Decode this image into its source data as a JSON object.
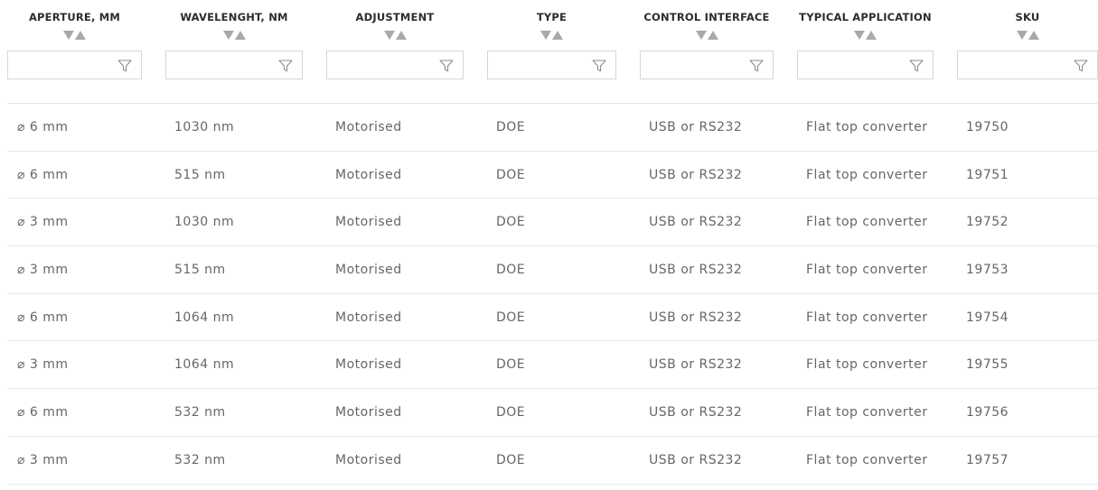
{
  "columns": [
    {
      "key": "aperture",
      "label": "APERTURE, MM"
    },
    {
      "key": "wavelength",
      "label": "WAVELENGHT, NM"
    },
    {
      "key": "adjustment",
      "label": "ADJUSTMENT"
    },
    {
      "key": "type",
      "label": "TYPE"
    },
    {
      "key": "interface",
      "label": "CONTROL INTERFACE"
    },
    {
      "key": "application",
      "label": "TYPICAL APPLICATION"
    },
    {
      "key": "sku",
      "label": "SKU"
    }
  ],
  "filters": [
    "",
    "",
    "",
    "",
    "",
    "",
    ""
  ],
  "icons": {
    "sort_down": "sort-desc-icon",
    "sort_up": "sort-asc-icon",
    "filter": "funnel-filter-icon"
  },
  "colors": {
    "header_text": "#2c2c2c",
    "cell_text": "#666666",
    "sort_arrow": "#a9a9a9",
    "border": "#d6d6d6"
  },
  "rows": [
    [
      "⌀ 6 mm",
      "1030 nm",
      "Motorised",
      "DOE",
      "USB or RS232",
      "Flat top converter",
      "19750"
    ],
    [
      "⌀ 6 mm",
      "515 nm",
      "Motorised",
      "DOE",
      "USB or RS232",
      "Flat top converter",
      "19751"
    ],
    [
      "⌀ 3 mm",
      "1030 nm",
      "Motorised",
      "DOE",
      "USB or RS232",
      "Flat top converter",
      "19752"
    ],
    [
      "⌀ 3 mm",
      "515 nm",
      "Motorised",
      "DOE",
      "USB or RS232",
      "Flat top converter",
      "19753"
    ],
    [
      "⌀ 6 mm",
      "1064 nm",
      "Motorised",
      "DOE",
      "USB or RS232",
      "Flat top converter",
      "19754"
    ],
    [
      "⌀ 3 mm",
      "1064 nm",
      "Motorised",
      "DOE",
      "USB or RS232",
      "Flat top converter",
      "19755"
    ],
    [
      "⌀ 6 mm",
      "532 nm",
      "Motorised",
      "DOE",
      "USB or RS232",
      "Flat top converter",
      "19756"
    ],
    [
      "⌀ 3 mm",
      "532 nm",
      "Motorised",
      "DOE",
      "USB or RS232",
      "Flat top converter",
      "19757"
    ]
  ]
}
